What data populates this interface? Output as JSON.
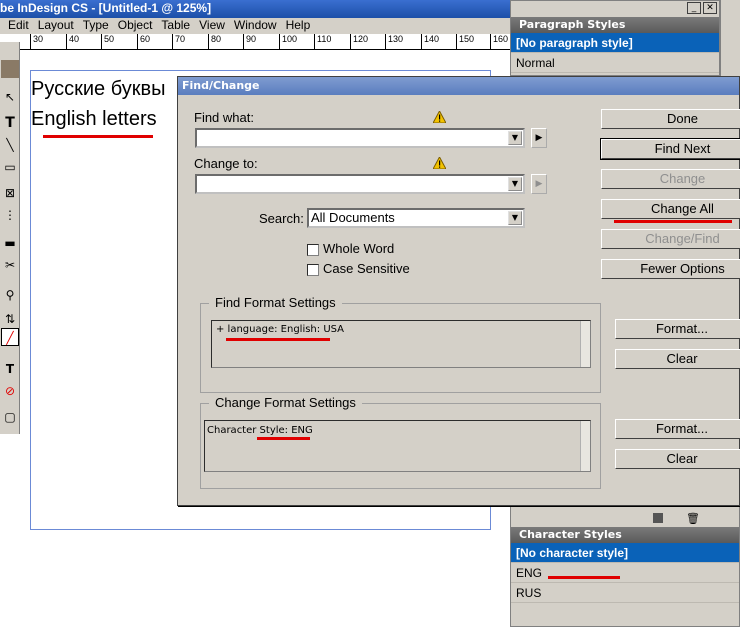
{
  "app": {
    "title": "be InDesign CS - [Untitled-1 @ 125%]"
  },
  "menu": [
    "Edit",
    "Layout",
    "Type",
    "Object",
    "Table",
    "View",
    "Window",
    "Help"
  ],
  "ruler": [
    "30",
    "40",
    "50",
    "60",
    "70",
    "80",
    "90",
    "100",
    "110",
    "120",
    "130",
    "140",
    "150",
    "160"
  ],
  "document": {
    "line1": "Русские буквы",
    "line2": "English letters"
  },
  "paragraph_styles": {
    "title": "Paragraph Styles",
    "items": [
      "[No paragraph style]",
      "Normal"
    ]
  },
  "character_styles": {
    "title": "Character Styles",
    "items": [
      "[No character style]",
      "ENG",
      "RUS"
    ]
  },
  "dialog": {
    "title": "Find/Change",
    "find_label": "Find what:",
    "find_value": "",
    "change_label": "Change to:",
    "change_value": "",
    "search_label": "Search:",
    "search_value": "All Documents",
    "whole_word": "Whole Word",
    "case_sensitive": "Case Sensitive",
    "buttons": {
      "done": "Done",
      "find_next": "Find Next",
      "change": "Change",
      "change_all": "Change All",
      "change_find": "Change/Find",
      "fewer_options": "Fewer Options"
    },
    "find_format": {
      "title": "Find Format Settings",
      "text": "+ language: English: USA",
      "format_btn": "Format...",
      "clear_btn": "Clear"
    },
    "change_format": {
      "title": "Change Format Settings",
      "text": "Character Style: ENG",
      "format_btn": "Format...",
      "clear_btn": "Clear"
    }
  },
  "colors": {
    "highlight": "#0a62b8",
    "marker": "#e00000"
  }
}
